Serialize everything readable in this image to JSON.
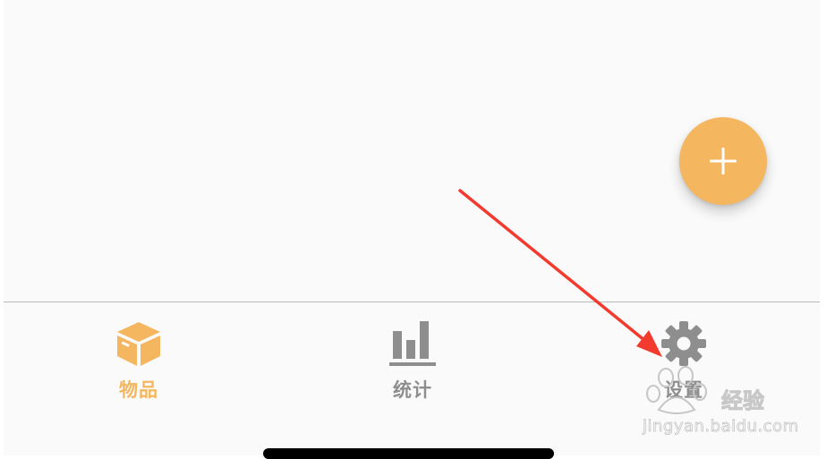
{
  "colors": {
    "accent": "#F4B65E",
    "inactive": "#8E8E8E",
    "background": "#FAFAFA",
    "annotation_arrow": "#F23A2E"
  },
  "fab": {
    "icon": "plus-icon"
  },
  "tabs": [
    {
      "label": "物品",
      "icon": "box-icon",
      "selected": true
    },
    {
      "label": "统计",
      "icon": "bar-chart-icon",
      "selected": false
    },
    {
      "label": "设置",
      "icon": "gear-icon",
      "selected": false
    }
  ],
  "watermark": {
    "brand": "经验",
    "url": "jingyan.baidu.com"
  }
}
